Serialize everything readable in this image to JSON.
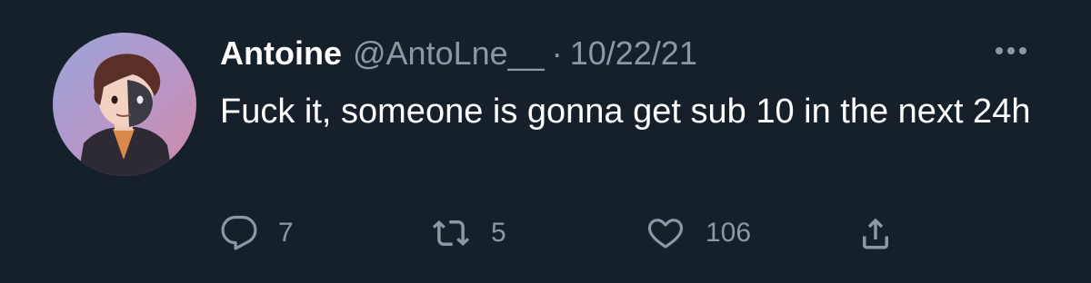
{
  "tweet": {
    "author_name": "Antoine",
    "handle": "@AntoLne__",
    "separator": "·",
    "date": "10/22/21",
    "text": "Fuck it, someone is gonna get sub 10 in the next 24h"
  },
  "actions": {
    "reply_count": "7",
    "retweet_count": "5",
    "like_count": "106"
  },
  "icons": {
    "reply": "reply-icon",
    "retweet": "retweet-icon",
    "like": "heart-icon",
    "share": "share-icon",
    "more": "more-options-icon"
  },
  "colors": {
    "background": "#15202b",
    "primary_text": "#ffffff",
    "secondary_text": "#8b98a5"
  }
}
